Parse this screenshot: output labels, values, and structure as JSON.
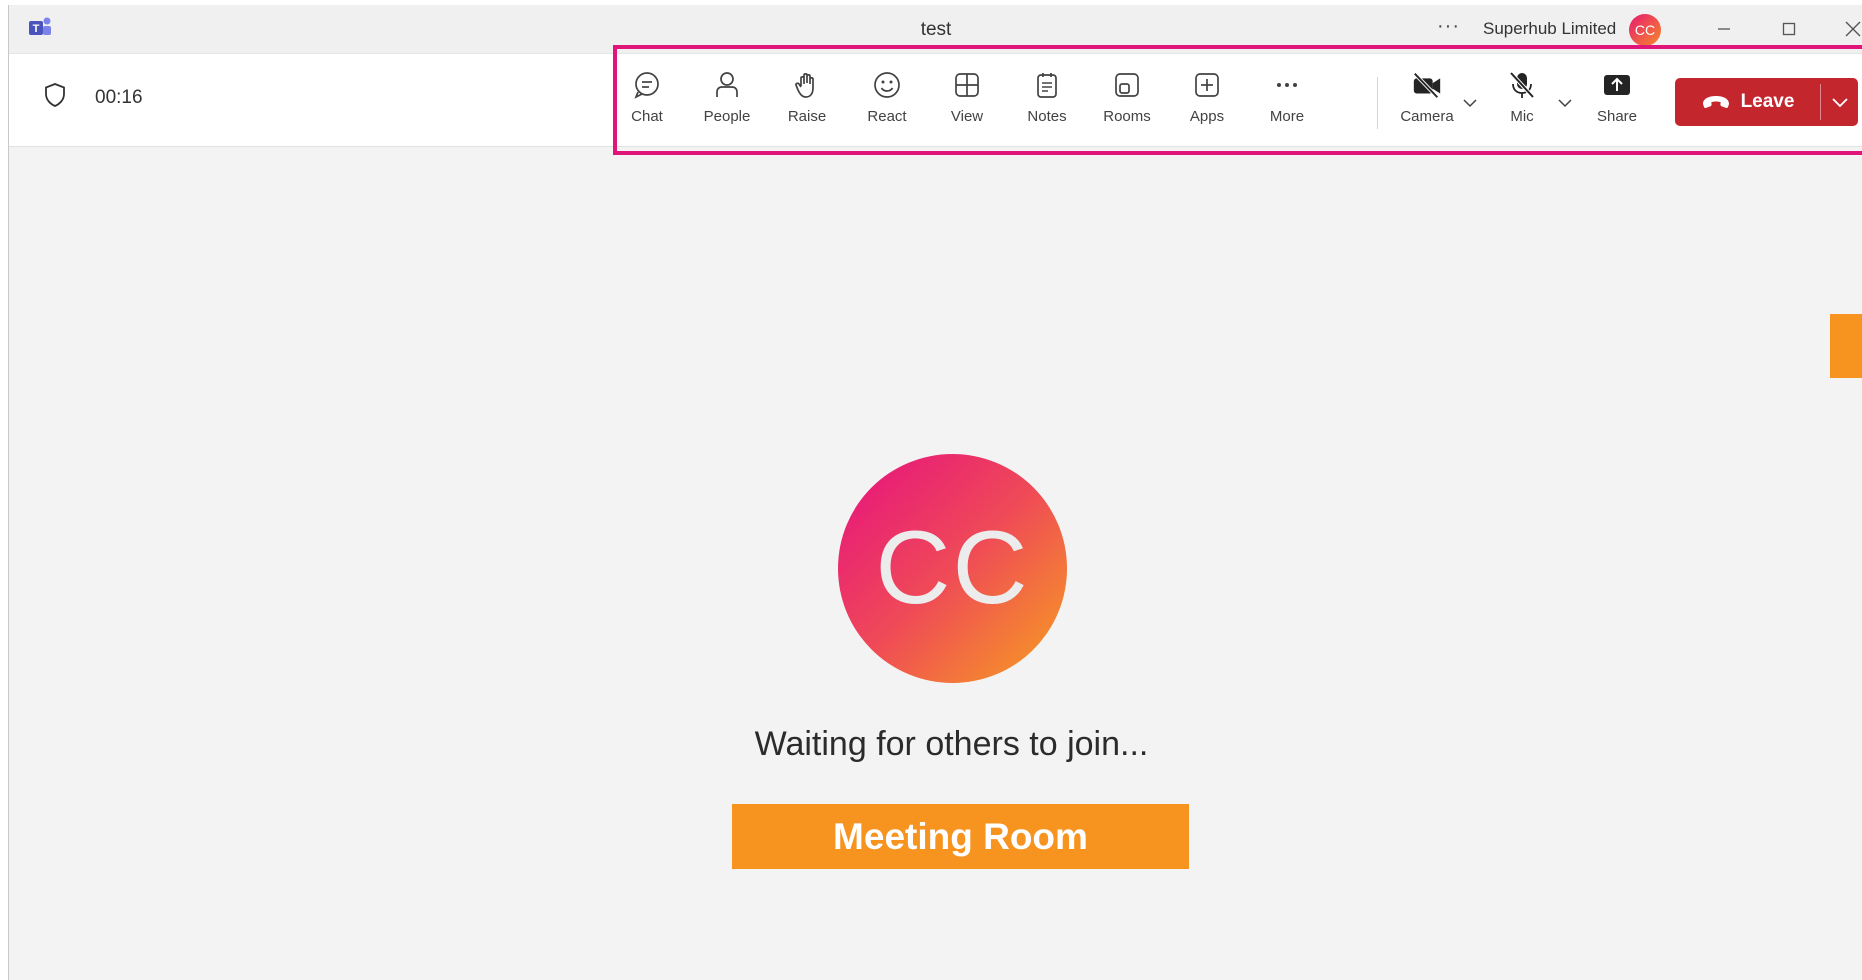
{
  "titlebar": {
    "title": "test",
    "more_label": "···",
    "tenant": "Superhub Limited",
    "avatar_initials": "CC"
  },
  "meeting": {
    "timer": "00:16"
  },
  "toolbar": {
    "items": [
      {
        "label": "Chat",
        "icon": "chat-icon"
      },
      {
        "label": "People",
        "icon": "people-icon"
      },
      {
        "label": "Raise",
        "icon": "raise-hand-icon"
      },
      {
        "label": "React",
        "icon": "smiley-icon"
      },
      {
        "label": "View",
        "icon": "grid-view-icon"
      },
      {
        "label": "Notes",
        "icon": "notes-icon"
      },
      {
        "label": "Rooms",
        "icon": "rooms-icon"
      },
      {
        "label": "Apps",
        "icon": "apps-plus-icon"
      },
      {
        "label": "More",
        "icon": "more-dots-icon"
      }
    ],
    "camera_label": "Camera",
    "mic_label": "Mic",
    "share_label": "Share",
    "leave_label": "Leave"
  },
  "stage": {
    "avatar_initials": "CC",
    "waiting_text": "Waiting for others to join...",
    "overlay_label": "Meeting Room"
  },
  "colors": {
    "leave": "#c4262e",
    "highlight": "#e0157a",
    "overlay": "#f7941f",
    "avatar_start": "#e60f80",
    "avatar_end": "#f7a11e"
  }
}
